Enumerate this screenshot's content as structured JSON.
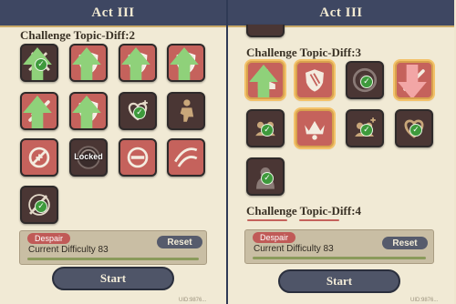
{
  "left_panel": {
    "header": "Act III",
    "section_title": "Challenge Topic-Diff:2",
    "icons": [
      {
        "name": "crossed-swords-shield-icon",
        "style": "dark",
        "checked": true,
        "arrow": "up"
      },
      {
        "name": "shield-heart-icon",
        "style": "red",
        "checked": false,
        "arrow": "up"
      },
      {
        "name": "shield-heart-icon",
        "style": "red",
        "checked": false,
        "arrow": "up"
      },
      {
        "name": "shield-heart-icon",
        "style": "red",
        "checked": false,
        "arrow": "up"
      },
      {
        "name": "broken-sword-icon",
        "style": "red",
        "checked": false,
        "arrow": "up"
      },
      {
        "name": "shield-heart-icon",
        "style": "red",
        "checked": false,
        "arrow": "up"
      },
      {
        "name": "heart-plus-icon",
        "style": "dark",
        "checked": true,
        "arrow": null
      },
      {
        "name": "kneeling-figure-icon",
        "style": "dark",
        "checked": false,
        "arrow": null
      },
      {
        "name": "no-heal-icon",
        "style": "red",
        "checked": false,
        "arrow": null
      },
      {
        "name": "locked-swirl-icon",
        "style": "dark",
        "checked": false,
        "arrow": null,
        "locked_label": "Locked"
      },
      {
        "name": "prohibited-icon",
        "style": "red",
        "checked": false,
        "arrow": null
      },
      {
        "name": "claw-slash-icon",
        "style": "red",
        "checked": false,
        "arrow": null
      },
      {
        "name": "swirl-blade-icon",
        "style": "dark",
        "checked": true,
        "arrow": null
      }
    ],
    "despair_label": "Despair",
    "difficulty_text": "Current Difficulty 83",
    "reset_label": "Reset",
    "start_label": "Start",
    "uid_text": "UID:9876..."
  },
  "right_panel": {
    "header": "Act III",
    "section_title": "Challenge Topic-Diff:3",
    "section_title_2": "Challenge Topic-Diff:4",
    "icons": [
      {
        "name": "boot-icon",
        "style": "red",
        "checked": false,
        "arrow": "up",
        "active": true
      },
      {
        "name": "shield-claw-icon",
        "style": "red",
        "checked": false,
        "arrow": null,
        "active": true
      },
      {
        "name": "target-circle-icon",
        "style": "dark",
        "checked": true,
        "arrow": null,
        "active": false
      },
      {
        "name": "broken-sword-icon",
        "style": "red",
        "checked": false,
        "arrow": "down",
        "active": true
      },
      {
        "name": "allies-icon",
        "style": "dark",
        "checked": true,
        "arrow": null,
        "active": false
      },
      {
        "name": "crown-icon",
        "style": "red",
        "checked": false,
        "arrow": null,
        "active": true
      },
      {
        "name": "allies-plus-icon",
        "style": "dark",
        "checked": true,
        "arrow": null,
        "active": false
      },
      {
        "name": "heart-icon",
        "style": "dark",
        "checked": true,
        "arrow": null,
        "active": false
      },
      {
        "name": "hooded-figure-icon",
        "style": "dark",
        "checked": true,
        "arrow": null,
        "active": false
      }
    ],
    "despair_label": "Despair",
    "difficulty_text": "Current Difficulty 83",
    "reset_label": "Reset",
    "start_label": "Start",
    "uid_text": "UID:9876..."
  },
  "colors": {
    "header_bg": "#3e4762",
    "panel_bg": "#f1ead5",
    "icon_red": "#c5625c",
    "icon_dark": "#4a3634",
    "check_green": "#3e9a3c",
    "accent_gold": "#d8a24e"
  }
}
